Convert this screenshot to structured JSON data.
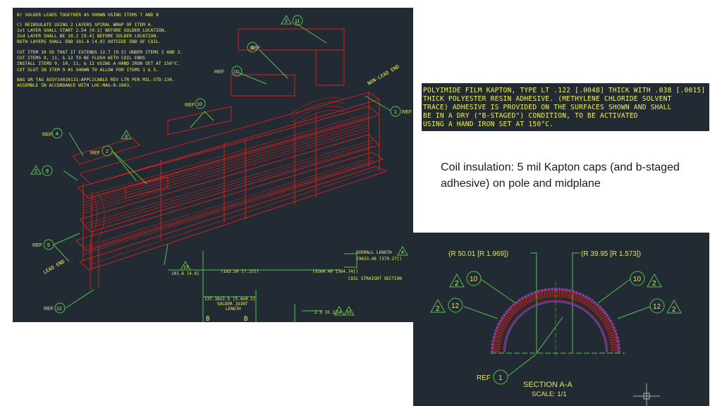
{
  "main_drawing": {
    "notes": [
      "B) SOLDER LEADS TOGETHER AS SHOWN USING ITEMS 7 AND 8",
      "C) REINSULATE USING 2 LAYERS SPIRAL WRAP OF ITEM 6.",
      "   1st LAYER SHALL START 2.54 [0.1] BEFORE SOLDER LOCATION.",
      "   2nd LAYER SHALL BE 10.2 [0.4] BEFORE SOLDER LOCATION.",
      "   BOTH LAYERS SHALL END 101.6 [4.0] OUTSIDE END OF COIL.",
      "CUT ITEM 10 SO THAT IT EXTENDS 12.7 [0.5] UNDER ITEMS 2 AND 3.",
      "CUT ITEMS 9, 11, & 12 TO BE FLUSH WITH COIL ENDS",
      "INSTALL ITEMS 9, 10, 11, & 12 USING A HAND IRON SET AT 150°C.",
      "CUT SLOT IN ITEM 9 AS SHOWN TO ALLOW FOR ITEMS 1 & 5.",
      "BAG OR TAG ASSY14010131-APPLICABLE REV LTR PER MIL-STD-130.",
      "ASSEMBLE IN ACCORDANCE WITH LHC-MAG-R-1003."
    ],
    "ref_prefix": "REF",
    "balloons": {
      "item1": "1",
      "item2": "2",
      "item3": "3",
      "item4": "4",
      "item5": "5",
      "item9": "9",
      "item10": "10",
      "item11": "11",
      "item12": "12",
      "tri2": "2",
      "tri3": "3",
      "tri4": "4"
    },
    "end_labels": {
      "non_lead": "NON-LEAD END",
      "lead": "LEAD END"
    },
    "dimensions": {
      "overall_length": "OVERALL LENGTH",
      "overall_value": "(9633.46 [379.27])",
      "straight_value": "(9264.40 [364.74])",
      "straight_label": "COIL STRAIGHT SECTION",
      "d1": "101.6 [4.0]",
      "d2": "(183.39 [7.22])",
      "d3": "137.16±2.5 [5.4±0.1]",
      "d3_label_1": "SOLDER JOINT",
      "d3_label_2": "LENGTH",
      "d4": "2.5 [0.1]",
      "section_mark": "B",
      "tri_label_1": "14",
      "tri_label_2": "15",
      "tri_label_3": "13"
    }
  },
  "note_box": {
    "lines": [
      "POLYIMIDE FILM KAPTON, TYPE LT .122 [.0048] THICK WITH .038 [.0015]",
      "THICK POLYESTER RESIN ADHESIVE. (METHYLENE CHLORIDE SOLVENT",
      "TRACE) ADHESIVE IS PROVIDED ON THE SURFACES SHOWN AND SHALL",
      "BE IN A DRY (\"B-STAGED\") CONDITION, TO BE ACTIVATED",
      "USING A HAND IRON SET AT 150°C."
    ]
  },
  "caption": "Coil insulation: 5 mil Kapton caps (and b-staged adhesive) on pole and midplane",
  "section_drawing": {
    "radius_left": "(R 50.01 [R 1.969])",
    "radius_right": "(R 39.95 [R 1.573])",
    "balloon_10": "10",
    "balloon_12": "12",
    "balloon_1": "1",
    "tri_2": "2",
    "ref": "REF",
    "section_title": "SECTION  A-A",
    "scale": "SCALE:  1/1"
  },
  "colors": {
    "cad_background": "#222b34",
    "cad_text": "#f0f060",
    "leader": "#52c44a",
    "geometry": "#e0201c",
    "insulation": "#5b4fd6"
  }
}
